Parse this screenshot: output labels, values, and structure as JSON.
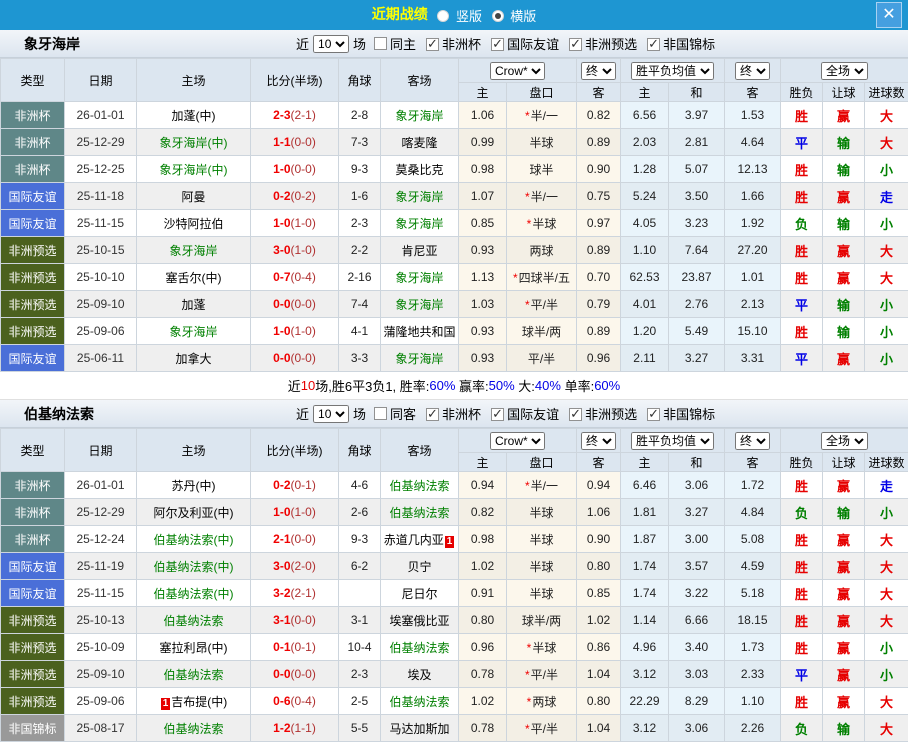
{
  "titlebar": {
    "title": "近期战绩",
    "radio_vertical": "竖版",
    "radio_horizontal": "横版",
    "close": "✕"
  },
  "columns": {
    "type": "类型",
    "date": "日期",
    "home": "主场",
    "score": "比分(半场)",
    "corner": "角球",
    "away": "客场",
    "odds_home": "主",
    "handicap": "盘口",
    "odds_away": "客",
    "avg_home": "主",
    "avg_draw": "和",
    "avg_away": "客",
    "wdl": "胜负",
    "let_goal": "让球",
    "goals": "进球数"
  },
  "selects": {
    "crow": "Crow*",
    "final": "终",
    "avg": "胜平负均值",
    "full": "全场"
  },
  "type_colors": {
    "非洲杯": "#5f8788",
    "国际友谊": "#4a6fd8",
    "非洲预选": "#4b611e",
    "非国锦标": "#999999"
  },
  "result_colors": {
    "胜": "#e60000",
    "平": "#0000e6",
    "负": "#008000",
    "赢": "#e60000",
    "输": "#008000",
    "大": "#e60000",
    "小": "#008000",
    "走": "#0000e6"
  },
  "sections": [
    {
      "team": "象牙海岸",
      "filter": {
        "prefix": "近",
        "count": "10",
        "suffix": "场",
        "same_label": "同主",
        "same_checked": false,
        "comps": [
          {
            "label": "非洲杯",
            "checked": true
          },
          {
            "label": "国际友谊",
            "checked": true
          },
          {
            "label": "非洲预选",
            "checked": true
          },
          {
            "label": "非国锦标",
            "checked": true
          }
        ]
      },
      "rows": [
        {
          "type": "非洲杯",
          "date": "26-01-01",
          "home": "加蓬(中)",
          "home_self": false,
          "home_rc": false,
          "score": "2-3",
          "half": "2-1",
          "corner": "2-8",
          "away": "象牙海岸",
          "away_self": true,
          "away_rc": false,
          "o_home": "1.06",
          "star": true,
          "hcap": "半/一",
          "o_away": "0.82",
          "a_home": "6.56",
          "a_draw": "3.97",
          "a_away": "1.53",
          "wdl": "胜",
          "let": "赢",
          "goal": "大"
        },
        {
          "type": "非洲杯",
          "date": "25-12-29",
          "home": "象牙海岸(中)",
          "home_self": true,
          "home_rc": false,
          "score": "1-1",
          "half": "0-0",
          "corner": "7-3",
          "away": "喀麦隆",
          "away_self": false,
          "away_rc": false,
          "o_home": "0.99",
          "star": false,
          "hcap": "半球",
          "o_away": "0.89",
          "a_home": "2.03",
          "a_draw": "2.81",
          "a_away": "4.64",
          "wdl": "平",
          "let": "输",
          "goal": "大"
        },
        {
          "type": "非洲杯",
          "date": "25-12-25",
          "home": "象牙海岸(中)",
          "home_self": true,
          "home_rc": false,
          "score": "1-0",
          "half": "0-0",
          "corner": "9-3",
          "away": "莫桑比克",
          "away_self": false,
          "away_rc": false,
          "o_home": "0.98",
          "star": false,
          "hcap": "球半",
          "o_away": "0.90",
          "a_home": "1.28",
          "a_draw": "5.07",
          "a_away": "12.13",
          "wdl": "胜",
          "let": "输",
          "goal": "小"
        },
        {
          "type": "国际友谊",
          "date": "25-11-18",
          "home": "阿曼",
          "home_self": false,
          "home_rc": false,
          "score": "0-2",
          "half": "0-2",
          "corner": "1-6",
          "away": "象牙海岸",
          "away_self": true,
          "away_rc": false,
          "o_home": "1.07",
          "star": true,
          "hcap": "半/一",
          "o_away": "0.75",
          "a_home": "5.24",
          "a_draw": "3.50",
          "a_away": "1.66",
          "wdl": "胜",
          "let": "赢",
          "goal": "走"
        },
        {
          "type": "国际友谊",
          "date": "25-11-15",
          "home": "沙特阿拉伯",
          "home_self": false,
          "home_rc": false,
          "score": "1-0",
          "half": "1-0",
          "corner": "2-3",
          "away": "象牙海岸",
          "away_self": true,
          "away_rc": false,
          "o_home": "0.85",
          "star": true,
          "hcap": "半球",
          "o_away": "0.97",
          "a_home": "4.05",
          "a_draw": "3.23",
          "a_away": "1.92",
          "wdl": "负",
          "let": "输",
          "goal": "小"
        },
        {
          "type": "非洲预选",
          "date": "25-10-15",
          "home": "象牙海岸",
          "home_self": true,
          "home_rc": false,
          "score": "3-0",
          "half": "1-0",
          "corner": "2-2",
          "away": "肯尼亚",
          "away_self": false,
          "away_rc": false,
          "o_home": "0.93",
          "star": false,
          "hcap": "两球",
          "o_away": "0.89",
          "a_home": "1.10",
          "a_draw": "7.64",
          "a_away": "27.20",
          "wdl": "胜",
          "let": "赢",
          "goal": "大"
        },
        {
          "type": "非洲预选",
          "date": "25-10-10",
          "home": "塞舌尔(中)",
          "home_self": false,
          "home_rc": false,
          "score": "0-7",
          "half": "0-4",
          "corner": "2-16",
          "away": "象牙海岸",
          "away_self": true,
          "away_rc": false,
          "o_home": "1.13",
          "star": true,
          "hcap": "四球半/五",
          "o_away": "0.70",
          "a_home": "62.53",
          "a_draw": "23.87",
          "a_away": "1.01",
          "wdl": "胜",
          "let": "赢",
          "goal": "大"
        },
        {
          "type": "非洲预选",
          "date": "25-09-10",
          "home": "加蓬",
          "home_self": false,
          "home_rc": false,
          "score": "0-0",
          "half": "0-0",
          "corner": "7-4",
          "away": "象牙海岸",
          "away_self": true,
          "away_rc": false,
          "o_home": "1.03",
          "star": true,
          "hcap": "平/半",
          "o_away": "0.79",
          "a_home": "4.01",
          "a_draw": "2.76",
          "a_away": "2.13",
          "wdl": "平",
          "let": "输",
          "goal": "小"
        },
        {
          "type": "非洲预选",
          "date": "25-09-06",
          "home": "象牙海岸",
          "home_self": true,
          "home_rc": false,
          "score": "1-0",
          "half": "1-0",
          "corner": "4-1",
          "away": "蒲隆地共和国",
          "away_self": false,
          "away_rc": false,
          "o_home": "0.93",
          "star": false,
          "hcap": "球半/两",
          "o_away": "0.89",
          "a_home": "1.20",
          "a_draw": "5.49",
          "a_away": "15.10",
          "wdl": "胜",
          "let": "输",
          "goal": "小"
        },
        {
          "type": "国际友谊",
          "date": "25-06-11",
          "home": "加拿大",
          "home_self": false,
          "home_rc": false,
          "score": "0-0",
          "half": "0-0",
          "corner": "3-3",
          "away": "象牙海岸",
          "away_self": true,
          "away_rc": false,
          "o_home": "0.93",
          "star": false,
          "hcap": "平/半",
          "o_away": "0.96",
          "a_home": "2.11",
          "a_draw": "3.27",
          "a_away": "3.31",
          "wdl": "平",
          "let": "赢",
          "goal": "小"
        }
      ],
      "summary": [
        {
          "t": "近",
          "c": "k"
        },
        {
          "t": "10",
          "c": "r"
        },
        {
          "t": "场,胜6平3负1, 胜率:",
          "c": "k"
        },
        {
          "t": "60%",
          "c": "b"
        },
        {
          "t": " 赢率:",
          "c": "k"
        },
        {
          "t": "50%",
          "c": "b"
        },
        {
          "t": " 大:",
          "c": "k"
        },
        {
          "t": "40%",
          "c": "b"
        },
        {
          "t": " 单率:",
          "c": "k"
        },
        {
          "t": "60%",
          "c": "b"
        }
      ]
    },
    {
      "team": "伯基纳法索",
      "filter": {
        "prefix": "近",
        "count": "10",
        "suffix": "场",
        "same_label": "同客",
        "same_checked": false,
        "comps": [
          {
            "label": "非洲杯",
            "checked": true
          },
          {
            "label": "国际友谊",
            "checked": true
          },
          {
            "label": "非洲预选",
            "checked": true
          },
          {
            "label": "非国锦标",
            "checked": true
          }
        ]
      },
      "rows": [
        {
          "type": "非洲杯",
          "date": "26-01-01",
          "home": "苏丹(中)",
          "home_self": false,
          "home_rc": false,
          "score": "0-2",
          "half": "0-1",
          "corner": "4-6",
          "away": "伯基纳法索",
          "away_self": true,
          "away_rc": false,
          "o_home": "0.94",
          "star": true,
          "hcap": "半/一",
          "o_away": "0.94",
          "a_home": "6.46",
          "a_draw": "3.06",
          "a_away": "1.72",
          "wdl": "胜",
          "let": "赢",
          "goal": "走"
        },
        {
          "type": "非洲杯",
          "date": "25-12-29",
          "home": "阿尔及利亚(中)",
          "home_self": false,
          "home_rc": false,
          "score": "1-0",
          "half": "1-0",
          "corner": "2-6",
          "away": "伯基纳法索",
          "away_self": true,
          "away_rc": false,
          "o_home": "0.82",
          "star": false,
          "hcap": "半球",
          "o_away": "1.06",
          "a_home": "1.81",
          "a_draw": "3.27",
          "a_away": "4.84",
          "wdl": "负",
          "let": "输",
          "goal": "小"
        },
        {
          "type": "非洲杯",
          "date": "25-12-24",
          "home": "伯基纳法索(中)",
          "home_self": true,
          "home_rc": false,
          "score": "2-1",
          "half": "0-0",
          "corner": "9-3",
          "away": "赤道几内亚",
          "away_self": false,
          "away_rc": true,
          "o_home": "0.98",
          "star": false,
          "hcap": "半球",
          "o_away": "0.90",
          "a_home": "1.87",
          "a_draw": "3.00",
          "a_away": "5.08",
          "wdl": "胜",
          "let": "赢",
          "goal": "大"
        },
        {
          "type": "国际友谊",
          "date": "25-11-19",
          "home": "伯基纳法索(中)",
          "home_self": true,
          "home_rc": false,
          "score": "3-0",
          "half": "2-0",
          "corner": "6-2",
          "away": "贝宁",
          "away_self": false,
          "away_rc": false,
          "o_home": "1.02",
          "star": false,
          "hcap": "半球",
          "o_away": "0.80",
          "a_home": "1.74",
          "a_draw": "3.57",
          "a_away": "4.59",
          "wdl": "胜",
          "let": "赢",
          "goal": "大"
        },
        {
          "type": "国际友谊",
          "date": "25-11-15",
          "home": "伯基纳法索(中)",
          "home_self": true,
          "home_rc": false,
          "score": "3-2",
          "half": "2-1",
          "corner": "",
          "away": "尼日尔",
          "away_self": false,
          "away_rc": false,
          "o_home": "0.91",
          "star": false,
          "hcap": "半球",
          "o_away": "0.85",
          "a_home": "1.74",
          "a_draw": "3.22",
          "a_away": "5.18",
          "wdl": "胜",
          "let": "赢",
          "goal": "大"
        },
        {
          "type": "非洲预选",
          "date": "25-10-13",
          "home": "伯基纳法索",
          "home_self": true,
          "home_rc": false,
          "score": "3-1",
          "half": "0-0",
          "corner": "3-1",
          "away": "埃塞俄比亚",
          "away_self": false,
          "away_rc": false,
          "o_home": "0.80",
          "star": false,
          "hcap": "球半/两",
          "o_away": "1.02",
          "a_home": "1.14",
          "a_draw": "6.66",
          "a_away": "18.15",
          "wdl": "胜",
          "let": "赢",
          "goal": "大"
        },
        {
          "type": "非洲预选",
          "date": "25-10-09",
          "home": "塞拉利昂(中)",
          "home_self": false,
          "home_rc": false,
          "score": "0-1",
          "half": "0-1",
          "corner": "10-4",
          "away": "伯基纳法索",
          "away_self": true,
          "away_rc": false,
          "o_home": "0.96",
          "star": true,
          "hcap": "半球",
          "o_away": "0.86",
          "a_home": "4.96",
          "a_draw": "3.40",
          "a_away": "1.73",
          "wdl": "胜",
          "let": "赢",
          "goal": "小"
        },
        {
          "type": "非洲预选",
          "date": "25-09-10",
          "home": "伯基纳法索",
          "home_self": true,
          "home_rc": false,
          "score": "0-0",
          "half": "0-0",
          "corner": "2-3",
          "away": "埃及",
          "away_self": false,
          "away_rc": false,
          "o_home": "0.78",
          "star": true,
          "hcap": "平/半",
          "o_away": "1.04",
          "a_home": "3.12",
          "a_draw": "3.03",
          "a_away": "2.33",
          "wdl": "平",
          "let": "赢",
          "goal": "小"
        },
        {
          "type": "非洲预选",
          "date": "25-09-06",
          "home": "吉布提(中)",
          "home_self": false,
          "home_rc": true,
          "score": "0-6",
          "half": "0-4",
          "corner": "2-5",
          "away": "伯基纳法索",
          "away_self": true,
          "away_rc": false,
          "o_home": "1.02",
          "star": true,
          "hcap": "两球",
          "o_away": "0.80",
          "a_home": "22.29",
          "a_draw": "8.29",
          "a_away": "1.10",
          "wdl": "胜",
          "let": "赢",
          "goal": "大"
        },
        {
          "type": "非国锦标",
          "date": "25-08-17",
          "home": "伯基纳法索",
          "home_self": true,
          "home_rc": false,
          "score": "1-2",
          "half": "1-1",
          "corner": "5-5",
          "away": "马达加斯加",
          "away_self": false,
          "away_rc": false,
          "o_home": "0.78",
          "star": true,
          "hcap": "平/半",
          "o_away": "1.04",
          "a_home": "3.12",
          "a_draw": "3.06",
          "a_away": "2.26",
          "wdl": "负",
          "let": "输",
          "goal": "大"
        }
      ],
      "summary": null
    }
  ]
}
